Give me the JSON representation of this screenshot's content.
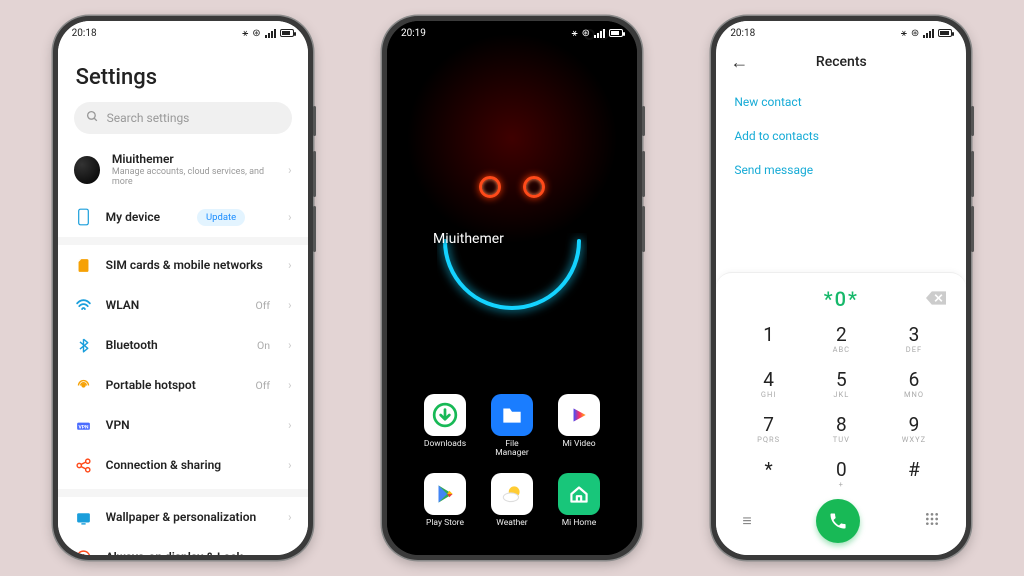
{
  "phone1": {
    "time": "20:18",
    "title": "Settings",
    "search_placeholder": "Search settings",
    "account": {
      "name": "Miuithemer",
      "sub": "Manage accounts, cloud services, and more"
    },
    "mydevice": {
      "label": "My device",
      "badge": "Update"
    },
    "rows": [
      {
        "icon": "sim-icon",
        "iconColor": "#f6a104",
        "label": "SIM cards & mobile networks",
        "value": ""
      },
      {
        "icon": "wifi-icon",
        "iconColor": "#1a9edb",
        "label": "WLAN",
        "value": "Off"
      },
      {
        "icon": "bt-icon",
        "iconColor": "#1a9edb",
        "label": "Bluetooth",
        "value": "On"
      },
      {
        "icon": "hotspot-icon",
        "iconColor": "#f6a104",
        "label": "Portable hotspot",
        "value": "Off"
      },
      {
        "icon": "vpn-icon",
        "iconColor": "#4a6cff",
        "label": "VPN",
        "value": ""
      },
      {
        "icon": "share-icon",
        "iconColor": "#ff4a1a",
        "label": "Connection & sharing",
        "value": ""
      }
    ],
    "rows2": [
      {
        "icon": "wallpaper-icon",
        "iconColor": "#1a9edb",
        "label": "Wallpaper & personalization"
      },
      {
        "icon": "aod-icon",
        "iconColor": "#ff4a1a",
        "label": "Always-on display & Lock"
      }
    ]
  },
  "phone2": {
    "time": "20:19",
    "username": "Miuithemer",
    "apps1": [
      {
        "name": "downloads-app",
        "label": "Downloads",
        "bg": "#ffffff",
        "glyphColor": "#18b956"
      },
      {
        "name": "file-manager-app",
        "label": "File\nManager",
        "bg": "#1a7dff",
        "glyphColor": "#ffffff"
      },
      {
        "name": "mi-video-app",
        "label": "Mi Video",
        "bg": "#ffffff",
        "glyphColor": "#ff2e63"
      }
    ],
    "apps2": [
      {
        "name": "play-store-app",
        "label": "Play Store",
        "bg": "#ffffff",
        "glyphColor": "#34a853"
      },
      {
        "name": "weather-app",
        "label": "Weather",
        "bg": "#ffffff",
        "glyphColor": "#ffcc33"
      },
      {
        "name": "mi-home-app",
        "label": "Mi Home",
        "bg": "#18c67a",
        "glyphColor": "#ffffff"
      }
    ]
  },
  "phone3": {
    "time": "20:18",
    "title": "Recents",
    "links": [
      "New contact",
      "Add to contacts",
      "Send message"
    ],
    "dialed": "*0*",
    "keys": [
      {
        "n": "1",
        "l": ""
      },
      {
        "n": "2",
        "l": "ABC"
      },
      {
        "n": "3",
        "l": "DEF"
      },
      {
        "n": "4",
        "l": "GHI"
      },
      {
        "n": "5",
        "l": "JKL"
      },
      {
        "n": "6",
        "l": "MNO"
      },
      {
        "n": "7",
        "l": "PQRS"
      },
      {
        "n": "8",
        "l": "TUV"
      },
      {
        "n": "9",
        "l": "WXYZ"
      },
      {
        "n": "*",
        "l": ""
      },
      {
        "n": "0",
        "l": "+"
      },
      {
        "n": "#",
        "l": ""
      }
    ]
  }
}
